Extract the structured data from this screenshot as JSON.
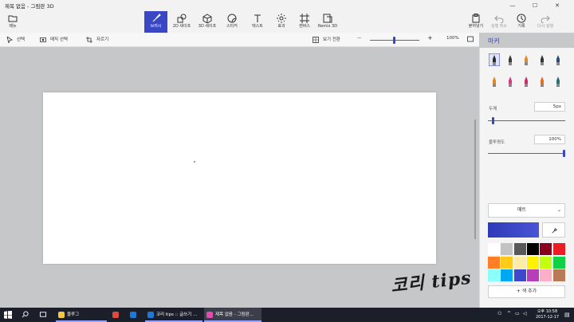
{
  "window": {
    "title": "제목 없음 - 그림판 3D"
  },
  "window_controls": {
    "minimize": "—",
    "maximize": "☐",
    "close": "✕"
  },
  "ribbon": {
    "menu_label": "메뉴",
    "tools": [
      {
        "label": "브러시",
        "icon": "brush-icon",
        "active": true
      },
      {
        "label": "2D 셰이프",
        "icon": "2d-shapes-icon"
      },
      {
        "label": "3D 셰이프",
        "icon": "3d-shapes-icon"
      },
      {
        "label": "스티커",
        "icon": "stickers-icon"
      },
      {
        "label": "텍스트",
        "icon": "text-icon"
      },
      {
        "label": "효과",
        "icon": "effects-icon"
      },
      {
        "label": "캔버스",
        "icon": "canvas-icon"
      },
      {
        "label": "Remix 3D",
        "icon": "remix3d-icon"
      }
    ],
    "right": [
      {
        "label": "붙여넣기",
        "icon": "paste-icon"
      },
      {
        "label": "실행 취소",
        "icon": "undo-icon",
        "disabled": true
      },
      {
        "label": "기록",
        "icon": "history-icon"
      },
      {
        "label": "다시 실행",
        "icon": "redo-icon",
        "disabled": true
      }
    ]
  },
  "subbar": {
    "select": "선택",
    "magic_select": "매직 선택",
    "crop": "자르기",
    "view_toggle": "보기 전환",
    "zoom_minus": "—",
    "zoom_plus": "+",
    "zoom": "100%"
  },
  "watermark": "코리 tips",
  "panel": {
    "title": "마커",
    "thickness_label": "두께",
    "thickness_value": "5px",
    "thickness_fraction": 0.05,
    "opacity_label": "불투명도",
    "opacity_value": "100%",
    "opacity_fraction": 1.0,
    "matte": "매트",
    "add_color": "+ 색 추가",
    "current_color": "#3a45c6",
    "brushes": [
      "marker-icon",
      "calligraphy-pen-icon",
      "oil-brush-icon",
      "watercolor-icon",
      "pixel-pen-icon",
      "pencil-icon",
      "eraser-icon",
      "crayon-icon",
      "spray-can-icon",
      "fill-icon"
    ],
    "swatches": [
      "#ffffff",
      "#c3c3c3",
      "#585858",
      "#000000",
      "#88001b",
      "#ec1c24",
      "#ff7f27",
      "#ffca18",
      "#fdeca6",
      "#fff200",
      "#c4ff0e",
      "#0ed145",
      "#8cfffb",
      "#00a8f3",
      "#3f48cc",
      "#b83dba",
      "#ffaec8",
      "#b97a56"
    ]
  },
  "taskbar": {
    "apps": [
      {
        "label": "블루그",
        "color": "#f4c842"
      },
      {
        "label": "",
        "color": "#e04a3a"
      },
      {
        "label": "",
        "color": "#1e78d6"
      },
      {
        "label": "코리 tips :: 글쓰기 ...",
        "color": "#1e78d6"
      },
      {
        "label": "제목 없음 - 그림판...",
        "color": "#e24bb0",
        "active": true
      }
    ],
    "time": "오후 10:58",
    "date": "2017-12-17"
  }
}
